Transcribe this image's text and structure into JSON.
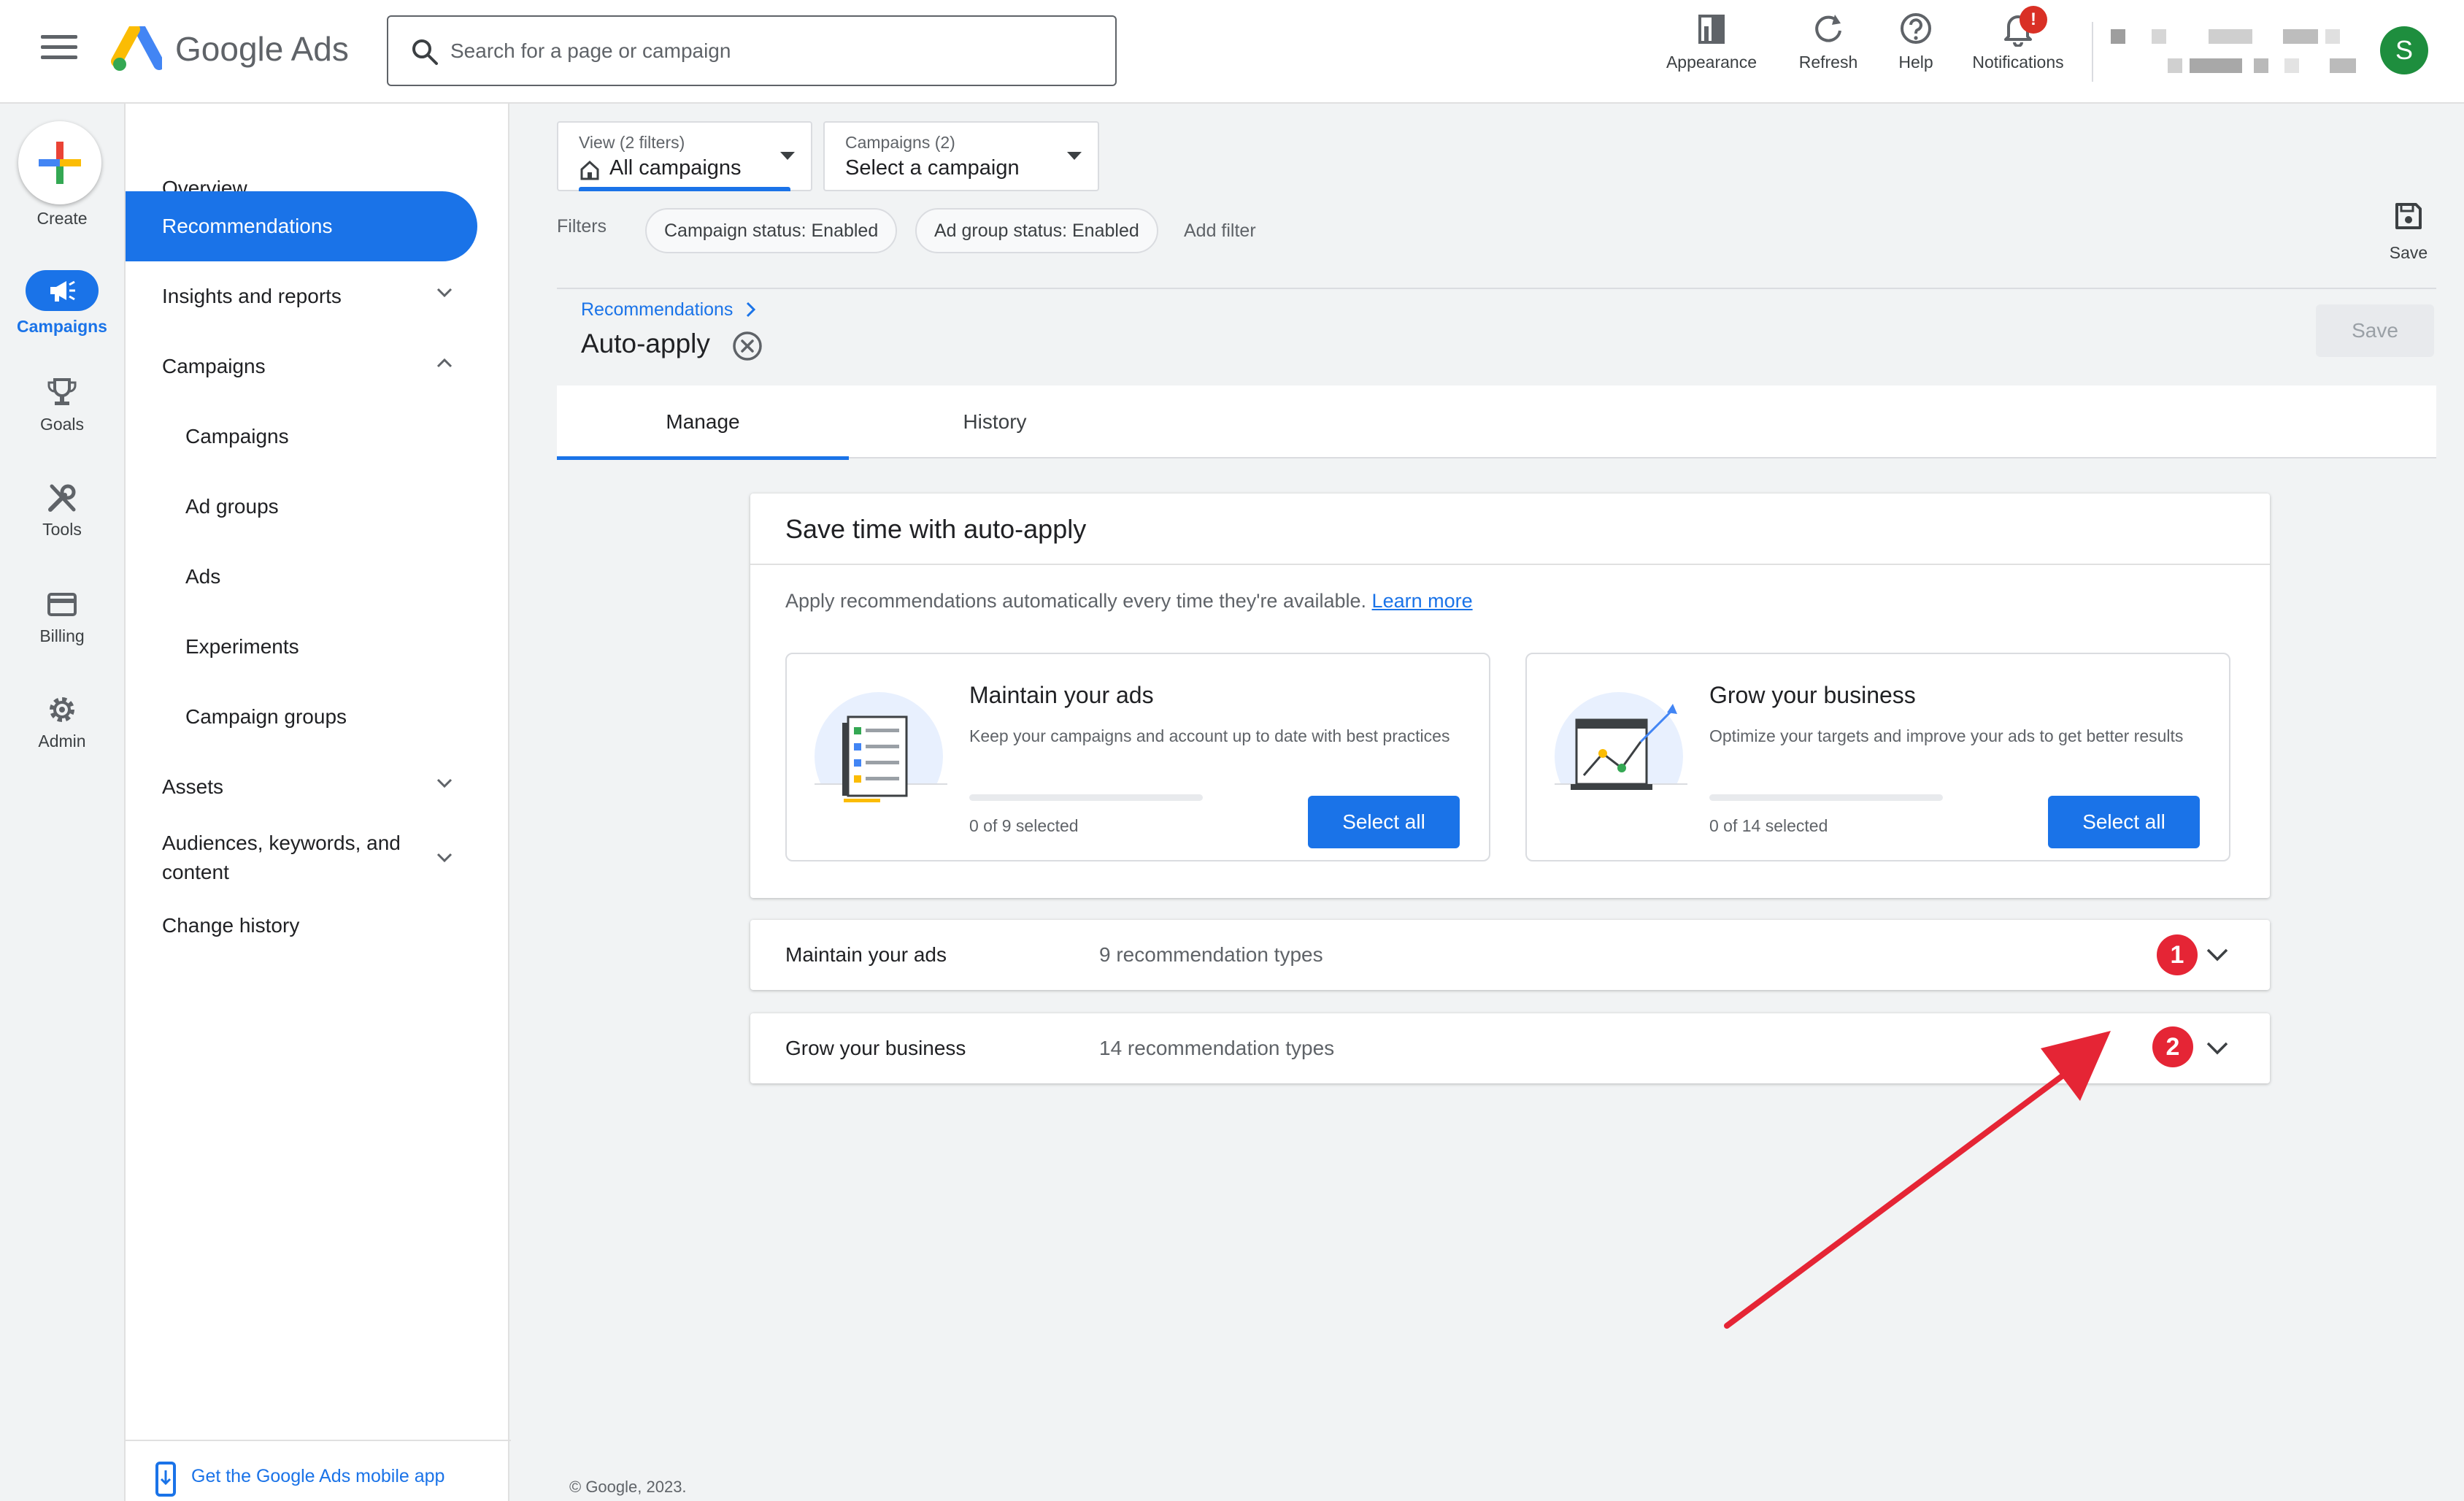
{
  "app": {
    "brand": "Google Ads"
  },
  "search": {
    "placeholder": "Search for a page or campaign"
  },
  "toolbar": {
    "appearance": "Appearance",
    "refresh": "Refresh",
    "help": "Help",
    "notifications": "Notifications",
    "notifications_badge": "!",
    "avatar_initial": "S"
  },
  "rail": {
    "create": "Create",
    "campaigns": "Campaigns",
    "goals": "Goals",
    "tools": "Tools",
    "billing": "Billing",
    "admin": "Admin"
  },
  "nav": {
    "overview": "Overview",
    "recommendations": "Recommendations",
    "insights": "Insights and reports",
    "campaigns_group": "Campaigns",
    "campaigns": "Campaigns",
    "ad_groups": "Ad groups",
    "ads": "Ads",
    "experiments": "Experiments",
    "campaign_groups": "Campaign groups",
    "assets": "Assets",
    "audiences_line1": "Audiences, keywords, and",
    "audiences_line2": "content",
    "change_history": "Change history",
    "mobile_app": "Get the Google Ads mobile app"
  },
  "view_dropdown": {
    "label": "View (2 filters)",
    "value": "All campaigns"
  },
  "campaign_dropdown": {
    "label": "Campaigns (2)",
    "value": "Select a campaign"
  },
  "filters": {
    "label": "Filters",
    "chips": [
      "Campaign status: Enabled",
      "Ad group status: Enabled"
    ],
    "add": "Add filter"
  },
  "side_save": "Save",
  "breadcrumb": "Recommendations",
  "page_title": "Auto-apply",
  "save_button": "Save",
  "tabs": [
    "Manage",
    "History"
  ],
  "card": {
    "title": "Save time with auto-apply",
    "description": "Apply recommendations automatically every time they're available.",
    "learn_more": "Learn more",
    "maintain": {
      "title": "Maintain your ads",
      "desc": "Keep your campaigns and account up to date with best practices",
      "count": "0 of 9 selected",
      "progress": 0,
      "button": "Select all"
    },
    "grow": {
      "title": "Grow your business",
      "desc": "Optimize your targets and improve your ads to get better results",
      "count": "0 of 14 selected",
      "progress": 0,
      "button": "Select all"
    }
  },
  "sections": [
    {
      "name": "Maintain your ads",
      "count": "9 recommendation types",
      "badge": "1"
    },
    {
      "name": "Grow your business",
      "count": "14 recommendation types",
      "badge": "2"
    }
  ],
  "footer": "© Google, 2023.",
  "colors": {
    "accent": "#1a73e8",
    "annotation": "#e52535"
  }
}
